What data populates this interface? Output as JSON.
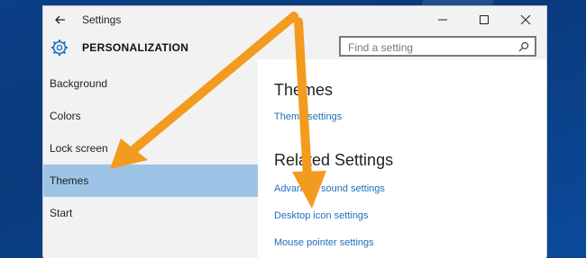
{
  "window": {
    "title": "Settings",
    "minimize_icon": "minimize-icon",
    "maximize_icon": "maximize-icon",
    "close_icon": "close-icon"
  },
  "header": {
    "title": "PERSONALIZATION",
    "search_placeholder": "Find a setting",
    "icons": {
      "back": "back-arrow-icon",
      "gear": "gear-icon",
      "search": "search-icon"
    }
  },
  "sidebar": {
    "items": [
      {
        "label": "Background",
        "selected": false
      },
      {
        "label": "Colors",
        "selected": false
      },
      {
        "label": "Lock screen",
        "selected": false
      },
      {
        "label": "Themes",
        "selected": true
      },
      {
        "label": "Start",
        "selected": false
      }
    ]
  },
  "main": {
    "section_themes_title": "Themes",
    "theme_settings_link": "Theme settings",
    "section_related_title": "Related Settings",
    "related_links": [
      "Advanced sound settings",
      "Desktop icon settings",
      "Mouse pointer settings"
    ]
  },
  "colors": {
    "selected_bg": "#9dc4e6",
    "link": "#1f6fc0",
    "arrow": "#f39b1f",
    "desktop": "#0a3f86"
  }
}
